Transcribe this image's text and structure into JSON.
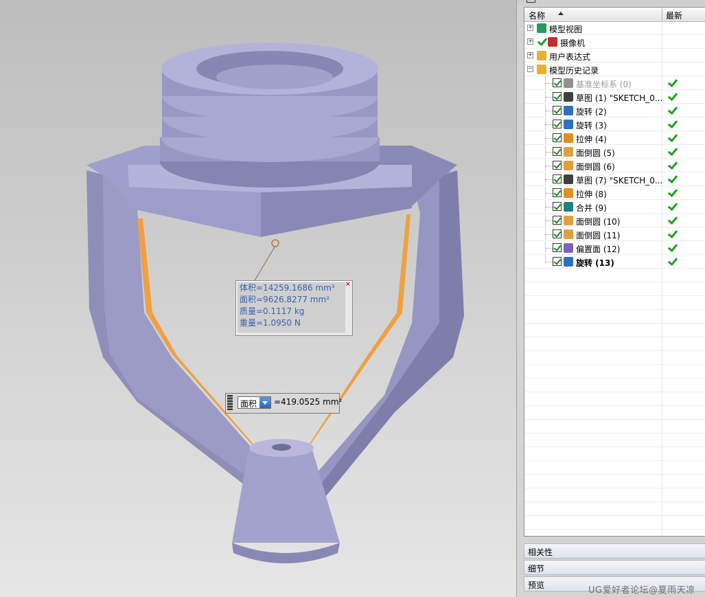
{
  "viewport": {
    "measure": {
      "lines": [
        "体积=14259.1686 mm³",
        "面积=9626.8277 mm²",
        "质量=0.1117 kg",
        "重量=1.0950 N"
      ],
      "close_glyph": "×"
    },
    "area_bar": {
      "type_value": "面积",
      "value_text": "=419.0525 mm²"
    },
    "colors": {
      "model": "#9695c0",
      "model_dark": "#77769f",
      "model_light": "#b9b8dc",
      "highlight": "#f0a040"
    }
  },
  "navigator": {
    "columns": {
      "name": "名称",
      "latest": "最新"
    },
    "nodes": [
      {
        "label": "模型视图",
        "icon": "model-view-icon",
        "expander": "+"
      },
      {
        "label": "摄像机",
        "icon": "camera-icon",
        "expander": "+"
      },
      {
        "label": "用户表达式",
        "icon": "folder-icon",
        "expander": "+"
      },
      {
        "label": "模型历史记录",
        "icon": "folder-open-icon",
        "expander": "−"
      }
    ],
    "history": [
      {
        "label": "基准坐标系 (0)",
        "icon": "datum-csys-icon",
        "style": "grey"
      },
      {
        "label": "草图 (1) \"SKETCH_0...",
        "icon": "sketch-icon",
        "style": ""
      },
      {
        "label": "旋转 (2)",
        "icon": "revolve-icon",
        "style": ""
      },
      {
        "label": "旋转 (3)",
        "icon": "revolve-icon",
        "style": ""
      },
      {
        "label": "拉伸 (4)",
        "icon": "extrude-icon",
        "style": ""
      },
      {
        "label": "面倒圆 (5)",
        "icon": "face-blend-icon",
        "style": ""
      },
      {
        "label": "面倒圆 (6)",
        "icon": "face-blend-icon",
        "style": ""
      },
      {
        "label": "草图 (7) \"SKETCH_0...",
        "icon": "sketch-icon",
        "style": ""
      },
      {
        "label": "拉伸 (8)",
        "icon": "extrude-icon",
        "style": ""
      },
      {
        "label": "合并 (9)",
        "icon": "unite-icon",
        "style": ""
      },
      {
        "label": "面倒圆 (10)",
        "icon": "face-blend-icon",
        "style": ""
      },
      {
        "label": "面倒圆 (11)",
        "icon": "face-blend-icon",
        "style": ""
      },
      {
        "label": "偏置面 (12)",
        "icon": "offset-face-icon",
        "style": ""
      },
      {
        "label": "旋转 (13)",
        "icon": "revolve-icon",
        "style": "bold"
      }
    ],
    "sections": [
      "相关性",
      "细节",
      "预览"
    ]
  },
  "watermark": "UG爱好者论坛@夏雨天凉"
}
